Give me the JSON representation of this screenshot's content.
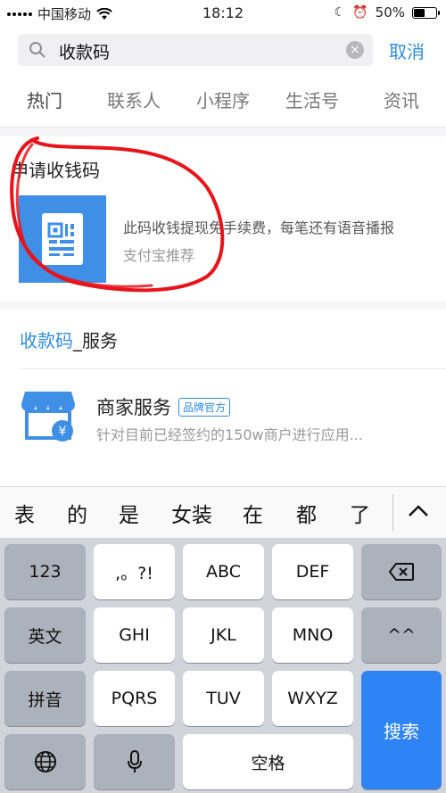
{
  "status": {
    "carrier": "中国移动",
    "time": "18:12",
    "battery": "50%"
  },
  "search": {
    "query": "收款码",
    "cancel": "取消"
  },
  "tabs": [
    "热门",
    "联系人",
    "小程序",
    "生活号",
    "资讯"
  ],
  "result1": {
    "title": "申请收钱码",
    "description": "此码收钱提现免手续费，每笔还有语音播报",
    "source": "支付宝推荐"
  },
  "services": {
    "keyword": "收款码",
    "suffix": "_服务",
    "item": {
      "name": "商家服务",
      "badge": "品牌官方",
      "description": "针对目前已经签约的150w商户进行应用..."
    }
  },
  "candidates": [
    "表",
    "的",
    "是",
    "女装",
    "在",
    "都",
    "了"
  ],
  "keyboard": {
    "row1": [
      "123",
      ",。?!",
      "ABC",
      "DEF"
    ],
    "row2": [
      "英文",
      "GHI",
      "JKL",
      "MNO",
      "^^"
    ],
    "row3": [
      "拼音",
      "PQRS",
      "TUV",
      "WXYZ"
    ],
    "search": "搜索",
    "space": "空格"
  }
}
